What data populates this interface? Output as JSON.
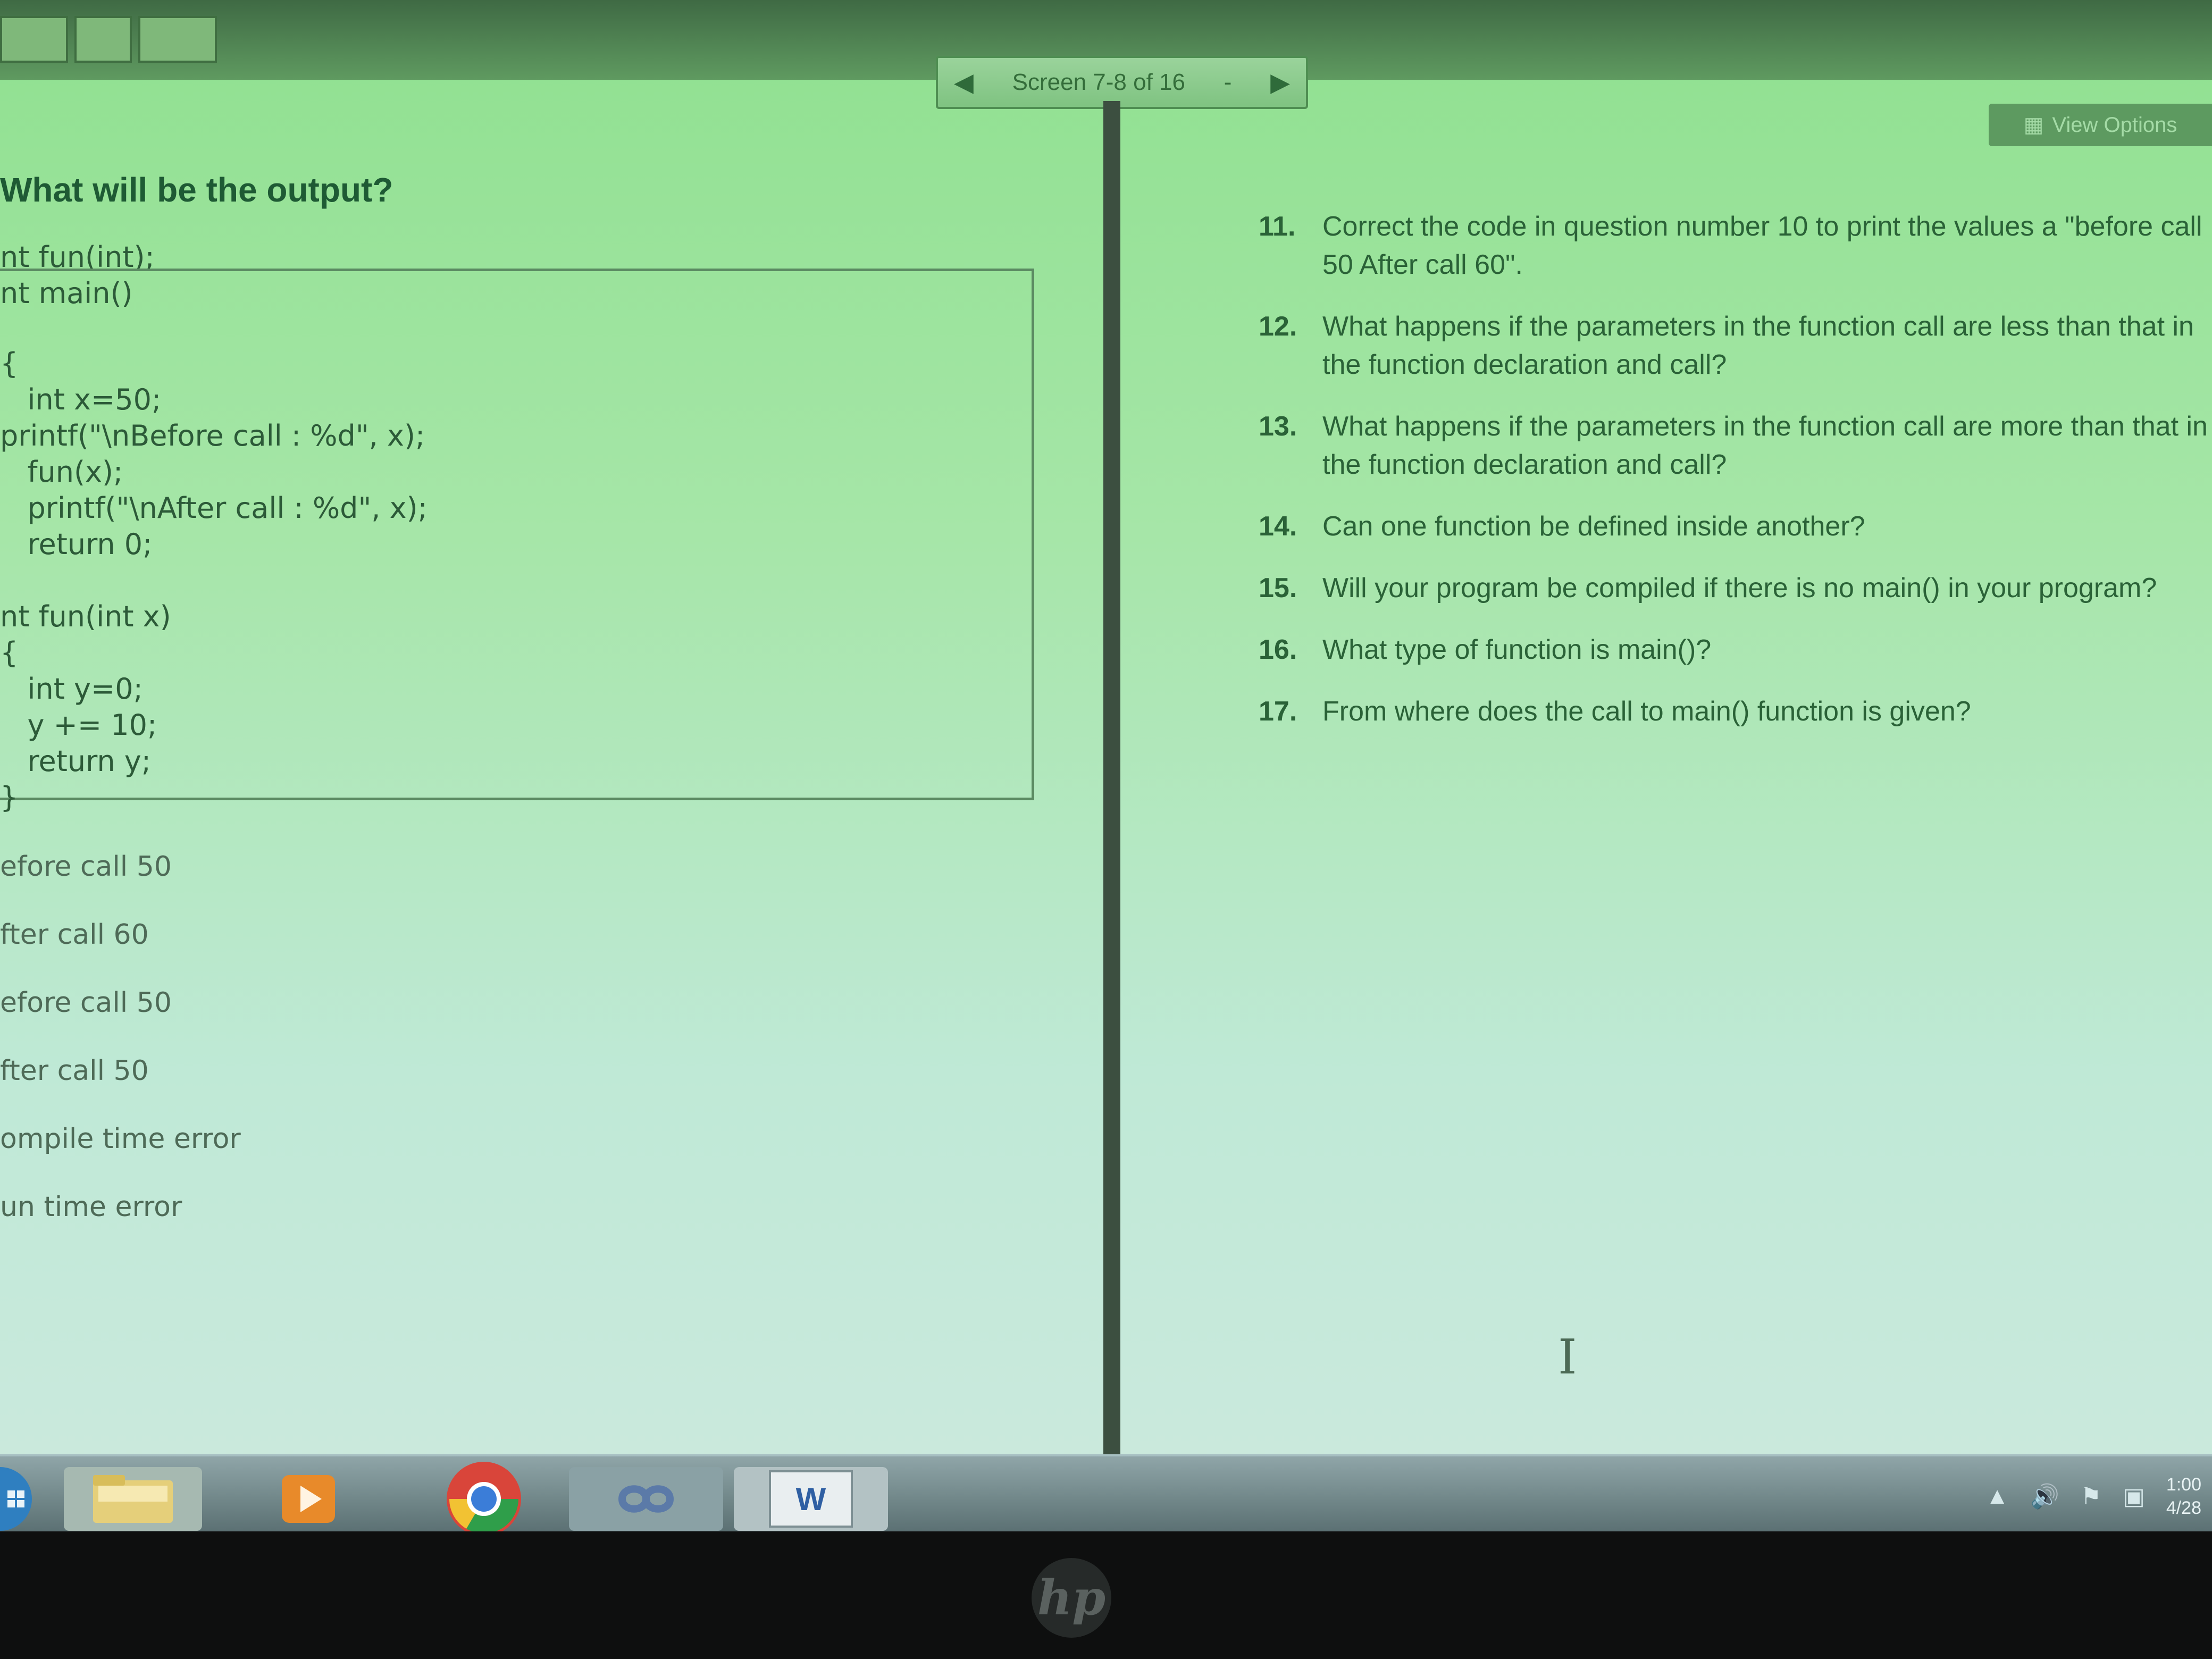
{
  "top_nav": {
    "screen_label": "Screen 7-8 of 16",
    "dropdown_glyph": "-",
    "prev_icon": "triangle-left",
    "next_icon": "triangle-right"
  },
  "view_options": {
    "label": "View Options"
  },
  "left_panel": {
    "title": "What will be the output?",
    "code_pre": [
      "nt fun(int);",
      "nt main()"
    ],
    "code_lines": [
      "{",
      "   int x=50;",
      "printf(\"\\nBefore call : %d\", x);",
      "   fun(x);",
      "   printf(\"\\nAfter call : %d\", x);",
      "   return 0;",
      "",
      "nt fun(int x)",
      "{",
      "   int y=0;",
      "   y += 10;",
      "   return y;",
      "}"
    ],
    "options": [
      "efore call 50",
      "fter call 60",
      "efore call 50",
      "fter call 50",
      "ompile time error",
      "un time error"
    ]
  },
  "right_panel": {
    "questions": [
      {
        "num": "11.",
        "text": "Correct the code in question number 10 to print the values a \"before call 50 After call 60\"."
      },
      {
        "num": "12.",
        "text": "What happens if the parameters in the function call are less than that in the function declaration and call?"
      },
      {
        "num": "13.",
        "text": "What happens if the parameters in the function call are more than that in the function declaration and call?"
      },
      {
        "num": "14.",
        "text": "Can one function be defined inside another?"
      },
      {
        "num": "15.",
        "text": "Will your program be compiled if there is no main() in your program?"
      },
      {
        "num": "16.",
        "text": "What type of function is main()?"
      },
      {
        "num": "17.",
        "text": "From where does the call to main() function is given?"
      }
    ]
  },
  "taskbar": {
    "apps": [
      {
        "name": "file-explorer"
      },
      {
        "name": "media-player"
      },
      {
        "name": "chrome"
      },
      {
        "name": "app-infinity"
      },
      {
        "name": "word"
      }
    ],
    "word_glyph": "W",
    "clock_time": "1:00",
    "clock_date": "4/28"
  },
  "bezel": {
    "logo_text": "hp"
  },
  "colors": {
    "screen_bg": "#a6e6a8",
    "question_text": "#2a6237",
    "code_text": "#2c5a38",
    "taskbar": "#6f8587"
  }
}
